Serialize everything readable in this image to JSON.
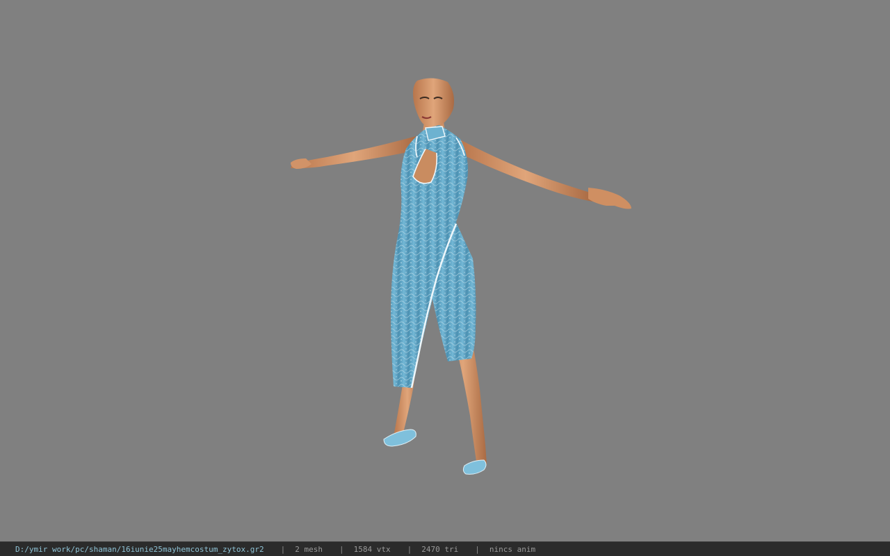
{
  "viewport": {
    "background": "#808080",
    "model_description_icon": "character-model-icon"
  },
  "status_bar": {
    "file_path": "D:/ymir work/pc/shaman/16iunie25mayhemcostum_zytox.gr2",
    "separator": "|",
    "mesh_count": "2 mesh",
    "vertex_count": "1584 vtx",
    "triangle_count": "2470 tri",
    "animation": "nincs anim"
  },
  "colors": {
    "status_bar_bg": "#2b2b2b",
    "path_text": "#8fc3d6",
    "stat_text": "#9a9a9a",
    "dress": "#5ea9c9",
    "skin": "#d89a6e"
  }
}
